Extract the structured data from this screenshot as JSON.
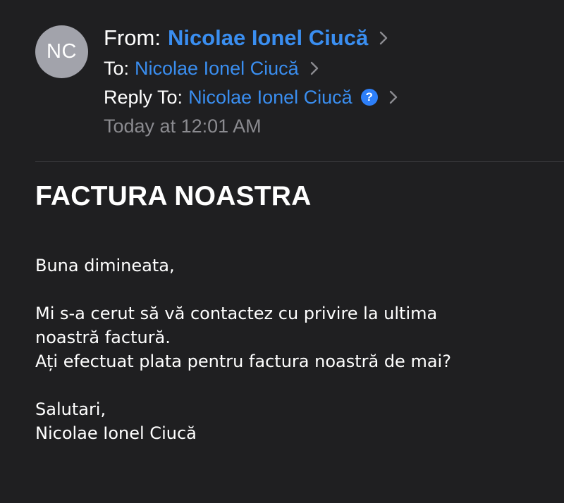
{
  "sender": {
    "initials": "NC",
    "from_label": "From:",
    "from_name": "Nicolae Ionel Ciucă",
    "to_label": "To:",
    "to_name": "Nicolae Ionel Ciucă",
    "reply_label": "Reply To:",
    "reply_name": "Nicolae Ionel Ciucă",
    "reply_badge": "?",
    "date": "Today at 12:01 AM"
  },
  "message": {
    "subject": "FACTURA NOASTRA",
    "greeting": "Buna dimineata,",
    "line1": "Mi s-a cerut să vă contactez cu privire la ultima",
    "line2": "noastră factură.",
    "line3": "Ați efectuat plata pentru factura noastră de mai?",
    "closing": "Salutari,",
    "signature": "Nicolae Ionel Ciucă"
  },
  "colors": {
    "background": "#1f1f21",
    "link": "#3a8ef0",
    "avatar": "#a2a3ab",
    "muted": "#8b8b90"
  }
}
